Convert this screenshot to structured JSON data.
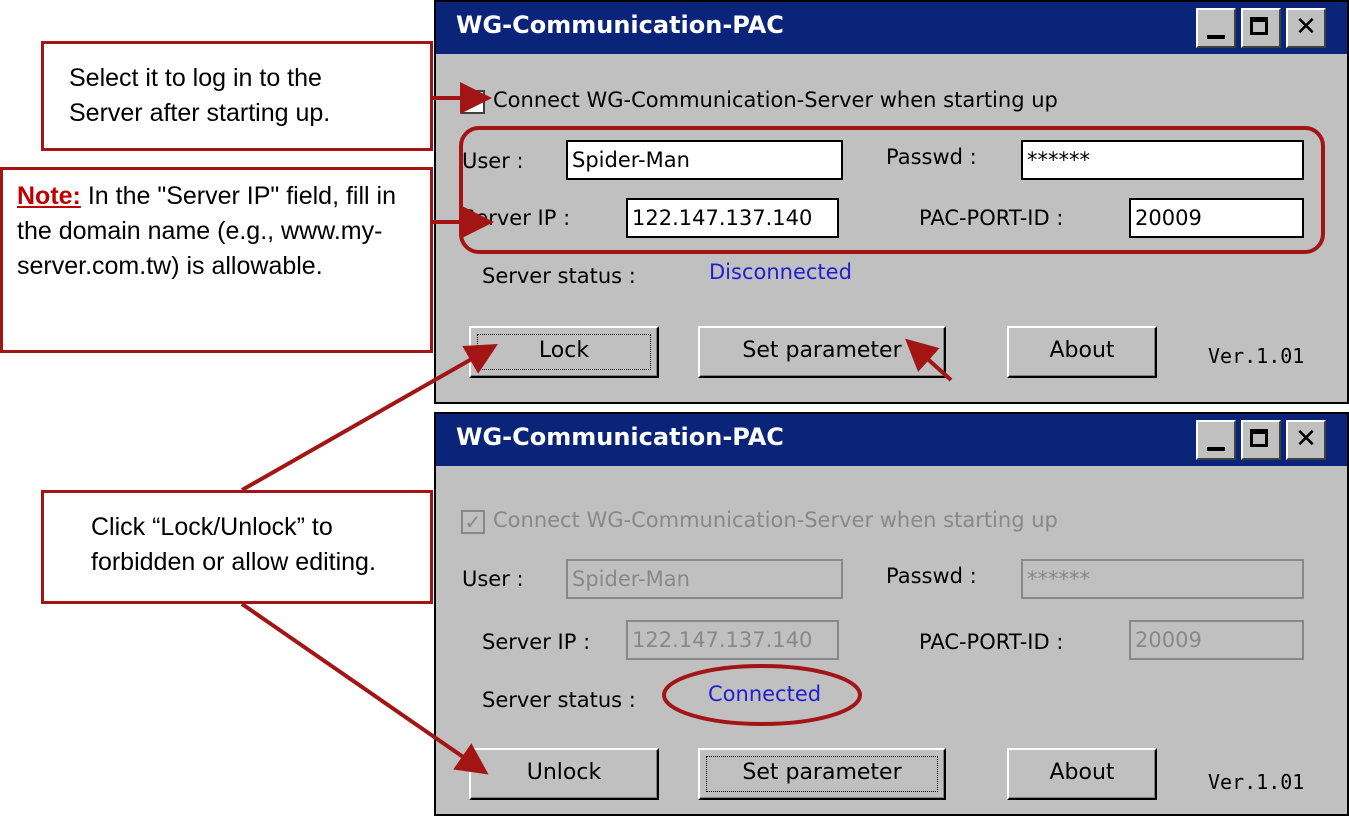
{
  "callouts": {
    "startup": {
      "lines": [
        "Select it to log in to the",
        "Server after starting up."
      ]
    },
    "note": {
      "label": "Note:",
      "text": " In the \"Server IP\" field, fill in the domain name (e.g., www.my-server.com.tw) is allowable."
    },
    "lock": {
      "lines": [
        "Click “Lock/Unlock” to",
        "forbidden or allow editing."
      ]
    }
  },
  "windows": [
    {
      "title": "WG-Communication-PAC",
      "checkbox_label": "Connect WG-Communication-Server when starting up",
      "checkbox_checked": true,
      "user_label": "User :",
      "user_value": "Spider-Man",
      "passwd_label": "Passwd :",
      "passwd_value": "******",
      "server_ip_label": "Server IP :",
      "server_ip_value": "122.147.137.140",
      "port_label": "PAC-PORT-ID :",
      "port_value": "20009",
      "status_label": "Server status :",
      "status_value": "Disconnected",
      "lock_button": "Lock",
      "set_button": "Set parameter",
      "about_button": "About",
      "version": "Ver.1.01",
      "close_glyph": "✕"
    },
    {
      "title": "WG-Communication-PAC",
      "checkbox_label": "Connect WG-Communication-Server when starting up",
      "checkbox_checked": true,
      "user_label": "User :",
      "user_value": "Spider-Man",
      "passwd_label": "Passwd :",
      "passwd_value": "******",
      "server_ip_label": "Server IP :",
      "server_ip_value": "122.147.137.140",
      "port_label": "PAC-PORT-ID :",
      "port_value": "20009",
      "status_label": "Server status :",
      "status_value": "Connected",
      "lock_button": "Unlock",
      "set_button": "Set parameter",
      "about_button": "About",
      "version": "Ver.1.01",
      "close_glyph": "✕"
    }
  ],
  "colors": {
    "annotation": "#a31515",
    "titlebar": "#0a247a",
    "status": "#1f1fd0",
    "window": "#c0c0c0"
  }
}
